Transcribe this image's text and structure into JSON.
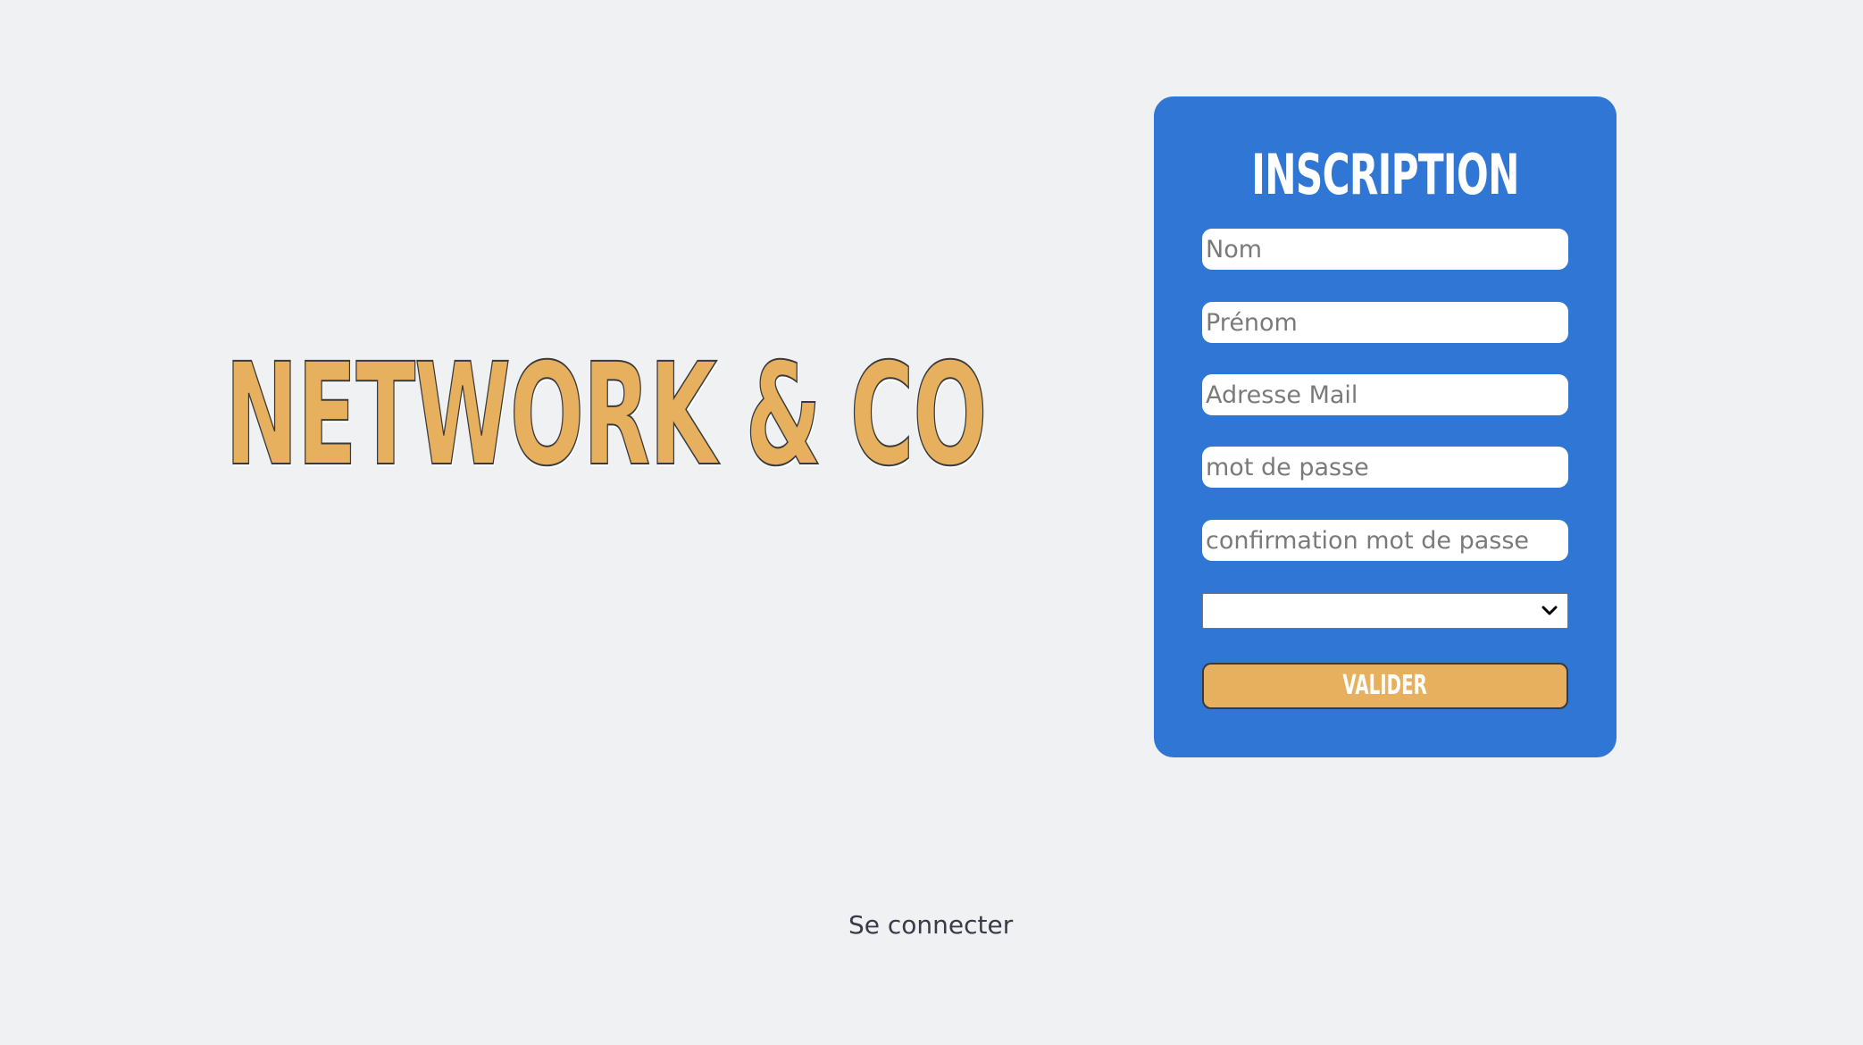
{
  "brand": {
    "title": "NETWORK & CO"
  },
  "signup_form": {
    "title": "INSCRIPTION",
    "fields": {
      "nom": {
        "value": "",
        "placeholder": "Nom"
      },
      "prenom": {
        "value": "",
        "placeholder": "Prénom"
      },
      "email": {
        "value": "",
        "placeholder": "Adresse Mail"
      },
      "password": {
        "value": "",
        "placeholder": "mot de passe"
      },
      "password_confirm": {
        "value": "",
        "placeholder": "confirmation mot de passe"
      }
    },
    "select": {
      "selected": ""
    },
    "submit_label": "VALIDER"
  },
  "footer": {
    "login_link": "Se connecter"
  },
  "colors": {
    "background": "#f0f1f3",
    "card": "#3076d4",
    "accent": "#e6b05e",
    "text_dark": "#3a3a4a"
  }
}
